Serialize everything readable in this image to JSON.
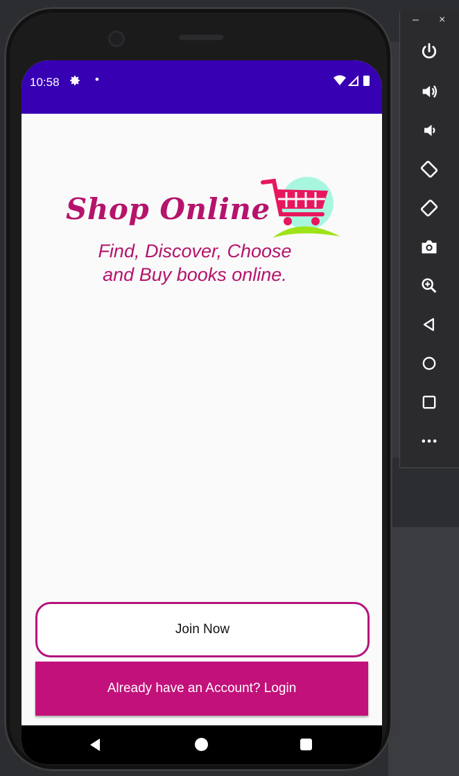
{
  "status_bar": {
    "time": "10:58",
    "settings_icon": "gear-icon",
    "dot": "•",
    "wifi_icon": "wifi-icon",
    "signal_icon": "signal-icon",
    "battery_icon": "battery-icon",
    "color": "#3700b3"
  },
  "logo": {
    "text": "Shop Online",
    "cart_icon": "shopping-cart-icon"
  },
  "tagline": {
    "line1": "Find, Discover, Choose",
    "line2": "and Buy books online."
  },
  "buttons": {
    "join_label": "Join Now",
    "login_label": "Already have an Account? Login"
  },
  "nav_bar": {
    "back_icon": "back-triangle-icon",
    "home_icon": "home-circle-icon",
    "recent_icon": "recent-square-icon"
  },
  "emulator_toolbar": {
    "minimize": "–",
    "close": "×",
    "items": [
      "power-icon",
      "volume-up-icon",
      "volume-down-icon",
      "rotate-left-icon",
      "rotate-right-icon",
      "camera-icon",
      "zoom-icon",
      "back-icon",
      "home-icon",
      "overview-icon",
      "more-icon"
    ]
  },
  "colors": {
    "brand": "#b5146c",
    "login_button": "#c2117a",
    "join_border": "#b3137d"
  }
}
